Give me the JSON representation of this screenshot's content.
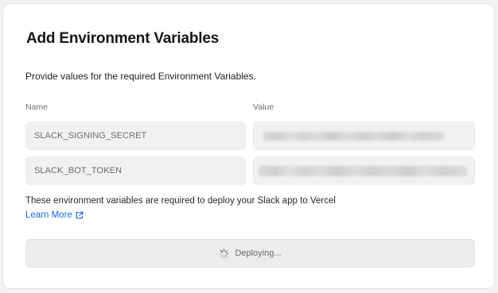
{
  "dialog": {
    "title": "Add Environment Variables",
    "subtitle": "Provide values for the required Environment Variables."
  },
  "columns": {
    "name": "Name",
    "value": "Value"
  },
  "variables": [
    {
      "name": "SLACK_SIGNING_SECRET",
      "value_state": "obscured"
    },
    {
      "name": "SLACK_BOT_TOKEN",
      "value_state": "obscured"
    }
  ],
  "help": {
    "text": "These environment variables are required to deploy your Slack app to Vercel",
    "link_label": "Learn More",
    "link_icon": "external-link-icon",
    "link_color": "#1769e0"
  },
  "deploy": {
    "label": "Deploying...",
    "icon": "spinner-icon"
  }
}
